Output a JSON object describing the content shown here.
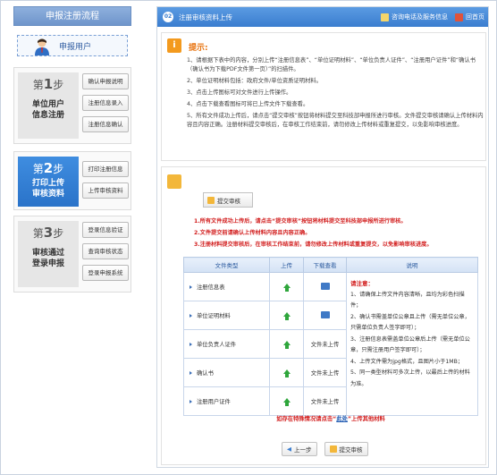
{
  "left": {
    "title": "申报注册流程",
    "user_label": "申报用户",
    "steps": [
      {
        "num_prefix": "第",
        "num": "1",
        "num_suffix": "步",
        "desc_line1": "单位用户",
        "desc_line2": "信息注册",
        "buttons": [
          "确认申报说明",
          "注册信息录入",
          "注册信息确认"
        ]
      },
      {
        "num_prefix": "第",
        "num": "2",
        "num_suffix": "步",
        "desc_line1": "打印上传",
        "desc_line2": "审核资料",
        "buttons": [
          "打印注册信息",
          "上传审核资料"
        ]
      },
      {
        "num_prefix": "第",
        "num": "3",
        "num_suffix": "步",
        "desc_line1": "审核通过",
        "desc_line2": "登录申报",
        "buttons": [
          "登录信息验证",
          "查询审核状态",
          "登录申报系统"
        ]
      }
    ]
  },
  "topbar": {
    "num": "02",
    "title": "注册审核资料上传",
    "link1": "咨询电话及服务信息",
    "link2": "回首页"
  },
  "tips": {
    "title": "提示:",
    "items": [
      "1、请根据下表中的内容，分别上传“注册信息表”、“单位证明材料”、“单位负责人证件”、“注册用户证件”和“确认书（确认书为下载PDF文件第一页）”的扫描件。",
      "2、单位证明材料包括：政府文件/单位资质证明材料。",
      "3、点击上传图标可对文件进行上传操作。",
      "4、点击下载查看图标可将已上传文件下载查看。",
      "5、所有文件成功上传后，请点击“提交审核”按钮将材料提交至科技部申报所进行审核。文件提交审核请确认上传材料内容且内容正确。注册材料提交审核后，在审核工作结束前，请勿修改上传材料或重复提交，以免影响审核进度。"
    ]
  },
  "upload": {
    "submit_top": "提交审核",
    "red_notes": [
      "1.所有文件成功上传后，请点击“提交审核”按钮将材料提交至科技部申报所进行审核。",
      "2.文件提交前请确认上传材料内容且内容正确。",
      "3.注册材料提交审核后，在审核工作结束前，请勿修改上传材料或重复提交，以免影响审核进度。"
    ],
    "table": {
      "headers": [
        "文件类型",
        "上传",
        "下载查看",
        "说明"
      ],
      "rows": [
        {
          "name": "注册信息表",
          "upload": "icon",
          "download": "icon"
        },
        {
          "name": "单位证明材料",
          "upload": "icon",
          "download": "icon"
        },
        {
          "name": "单位负责人证件",
          "upload": "icon",
          "download": "文件未上传"
        },
        {
          "name": "确认书",
          "upload": "icon",
          "download": "文件未上传"
        },
        {
          "name": "注册用户证件",
          "upload": "icon",
          "download": "文件未上传"
        }
      ],
      "desc_title": "请注意：",
      "desc_items": [
        "1、请确保上传文件内容清晰，且均为彩色扫描件；",
        "2、确认书需盖单位公章且上传（需无单位公章，只需单位负责人签字即可）；",
        "3、注册信息表需盖单位公章后上传（需无单位公章，只需注册用户签字即可）；",
        "4、上传文件需为jpg格式，且图片小于1MB；",
        "5、同一类型材料可多次上传，以最后上传的材料为准。"
      ]
    },
    "footer_prefix": "如存在特殊情况请点击“",
    "footer_link": "此处",
    "footer_suffix": "”上传其他材料",
    "btn_prev": "上一步",
    "btn_submit": "提交审核"
  }
}
